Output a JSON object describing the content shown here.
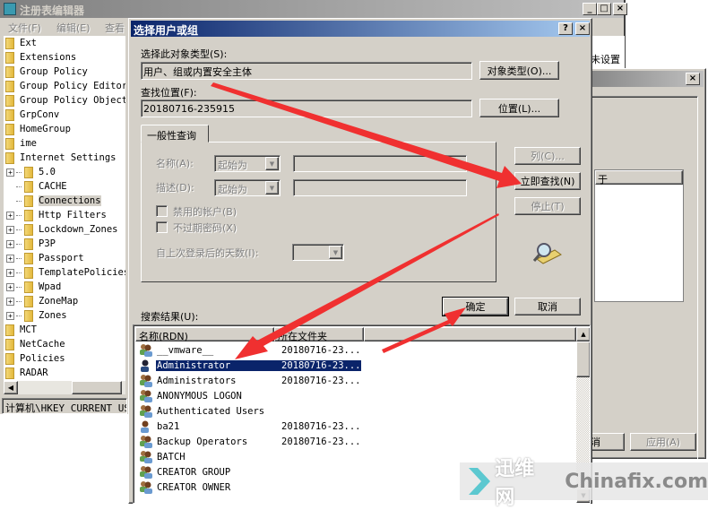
{
  "regedit": {
    "title": "注册表编辑器",
    "menu": [
      "文件(F)",
      "编辑(E)",
      "查看"
    ],
    "tree": [
      {
        "label": "Ext",
        "level": 0
      },
      {
        "label": "Extensions",
        "level": 0
      },
      {
        "label": "Group Policy",
        "level": 0
      },
      {
        "label": "Group Policy Editor",
        "level": 0
      },
      {
        "label": "Group Policy Objects",
        "level": 0
      },
      {
        "label": "GrpConv",
        "level": 0
      },
      {
        "label": "HomeGroup",
        "level": 0
      },
      {
        "label": "ime",
        "level": 0
      },
      {
        "label": "Internet Settings",
        "level": 0
      },
      {
        "label": "5.0",
        "level": 1,
        "expandable": true
      },
      {
        "label": "CACHE",
        "level": 1
      },
      {
        "label": "Connections",
        "level": 1,
        "selected": true
      },
      {
        "label": "Http Filters",
        "level": 1,
        "expandable": true
      },
      {
        "label": "Lockdown_Zones",
        "level": 1,
        "expandable": true
      },
      {
        "label": "P3P",
        "level": 1,
        "expandable": true
      },
      {
        "label": "Passport",
        "level": 1,
        "expandable": true
      },
      {
        "label": "TemplatePolicies",
        "level": 1,
        "expandable": true
      },
      {
        "label": "Wpad",
        "level": 1,
        "expandable": true
      },
      {
        "label": "ZoneMap",
        "level": 1,
        "expandable": true
      },
      {
        "label": "Zones",
        "level": 1,
        "expandable": true
      },
      {
        "label": "MCT",
        "level": 0
      },
      {
        "label": "NetCache",
        "level": 0
      },
      {
        "label": "Policies",
        "level": 0
      },
      {
        "label": "RADAR",
        "level": 0
      }
    ],
    "status": "计算机\\HKEY_CURRENT_USE",
    "right_value": "未设置"
  },
  "permissions_dialog": {
    "column_header_partial": "于",
    "cancel_partial": "消",
    "apply_label": "应用(A)"
  },
  "dialog": {
    "title": "选择用户或组",
    "help": "?",
    "close": "×",
    "object_type_label": "选择此对象类型(S):",
    "object_type_value": "用户、组或内置安全主体",
    "object_type_button": "对象类型(O)...",
    "location_label": "查找位置(F):",
    "location_value": "20180716-235915",
    "location_button": "位置(L)...",
    "tab": "一般性查询",
    "name_label": "名称(A):",
    "name_mode": "起始为",
    "desc_label": "描述(D):",
    "desc_mode": "起始为",
    "disabled_accounts": "禁用的帐户(B)",
    "non_expiring": "不过期密码(X)",
    "days_label": "自上次登录后的天数(I):",
    "columns_button": "列(C)...",
    "find_now_button": "立即查找(N)",
    "stop_button": "停止(T)",
    "ok_button": "确定",
    "cancel_button": "取消",
    "results_label": "搜索结果(U):",
    "results_headers": [
      "名称(RDN)",
      "所在文件夹"
    ],
    "results": [
      {
        "name": "__vmware__",
        "folder": "20180716-23...",
        "icon": "group-icon"
      },
      {
        "name": "Administrator",
        "folder": "20180716-23...",
        "icon": "user-icon",
        "selected": true
      },
      {
        "name": "Administrators",
        "folder": "20180716-23...",
        "icon": "group-icon"
      },
      {
        "name": "ANONYMOUS LOGON",
        "folder": "",
        "icon": "group-icon"
      },
      {
        "name": "Authenticated Users",
        "folder": "",
        "icon": "group-icon"
      },
      {
        "name": "ba21",
        "folder": "20180716-23...",
        "icon": "user-icon"
      },
      {
        "name": "Backup Operators",
        "folder": "20180716-23...",
        "icon": "group-icon"
      },
      {
        "name": "BATCH",
        "folder": "",
        "icon": "group-icon"
      },
      {
        "name": "CREATOR GROUP",
        "folder": "",
        "icon": "group-icon"
      },
      {
        "name": "CREATOR OWNER",
        "folder": "",
        "icon": "group-icon"
      }
    ]
  },
  "watermark": {
    "cn": "迅维网",
    "en": "Chinafix.com"
  },
  "colors": {
    "titlebar_active": "#0a246a",
    "titlebar_active_end": "#a6caf0",
    "face": "#d4d0c8",
    "selection": "#0a246a",
    "arrow": "#f03030"
  }
}
